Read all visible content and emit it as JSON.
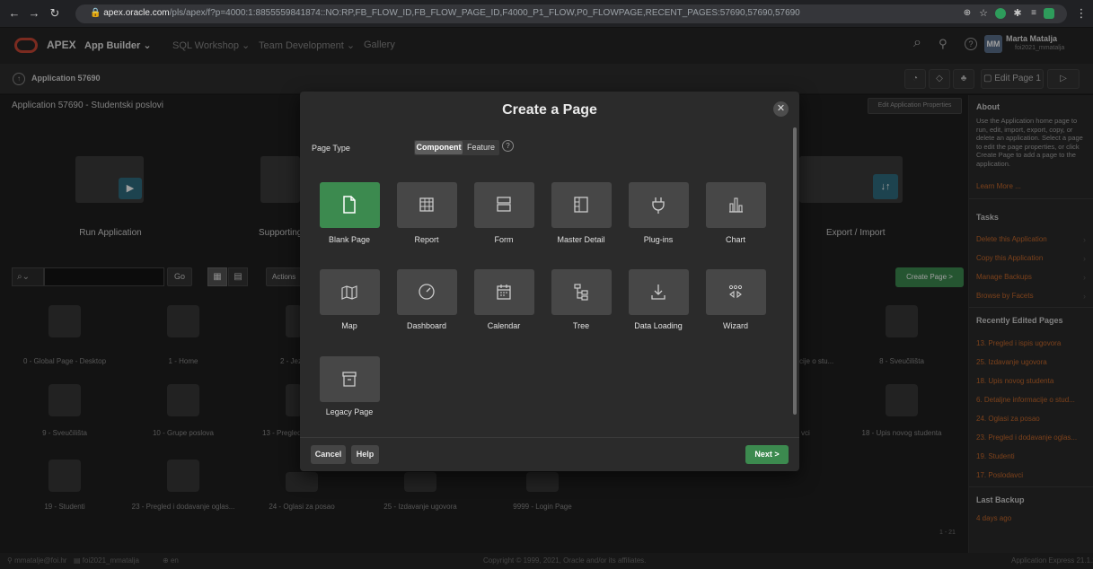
{
  "browser": {
    "url_host": "apex.oracle.com",
    "url_path": "/pls/apex/f?p=4000:1:8855559841874::NO:RP,FB_FLOW_ID,FB_FLOW_PAGE_ID,F4000_P1_FLOW,P0_FLOWPAGE,RECENT_PAGES:57690,57690,57690"
  },
  "apex_nav": {
    "logo_text": "APEX",
    "menus": [
      "App Builder",
      "SQL Workshop",
      "Team Development",
      "Gallery"
    ],
    "user_initials": "MM",
    "user_name": "Marta Matalja",
    "user_workspace": "foi2021_mmatalja"
  },
  "breadcrumb": {
    "label": "Application 57690",
    "edit_page_label": "Edit Page 1"
  },
  "main": {
    "app_title": "Application 57690 - Studentski poslovi",
    "edit_props_label": "Edit Application Properties",
    "big_tiles": [
      "Run Application",
      "Supporting Objects",
      "Export / Import"
    ],
    "search_go": "Go",
    "actions_label": "Actions",
    "create_page_label": "Create Page >",
    "pages": [
      "0 - Global Page - Desktop",
      "1 - Home",
      "2 - Jezici",
      "cije o stu...",
      "8 - Sveučilišta",
      "9 - Sveučilišta",
      "10 - Grupe poslova",
      "13 - Pregled",
      "vci",
      "18 - Upis novog studenta",
      "19 - Studenti",
      "23 - Pregled i dodavanje oglas...",
      "24 - Oglasi za posao",
      "25 - Izdavanje ugovora",
      "9999 - Login Page"
    ],
    "pagination": "1 - 21"
  },
  "sidebar": {
    "about_heading": "About",
    "about_text": "Use the Application home page to run, edit, import, export, copy, or delete an application. Select a page to edit the page properties, or click Create Page to add a page to the application.",
    "learn_more": "Learn More ...",
    "tasks_heading": "Tasks",
    "tasks": [
      "Delete this Application",
      "Copy this Application",
      "Manage Backups",
      "Browse by Facets"
    ],
    "recent_heading": "Recently Edited Pages",
    "recent": [
      "13. Pregled i ispis ugovora",
      "25. Izdavanje ugovora",
      "18. Upis novog studenta",
      "6. Detaljne informacije o stud...",
      "24. Oglasi za posao",
      "23. Pregled i dodavanje oglas...",
      "19. Studenti",
      "17. Poslodavci"
    ],
    "backup_heading": "Last Backup",
    "backup_value": "4 days ago"
  },
  "dialog": {
    "title": "Create a Page",
    "page_type_label": "Page Type",
    "toggle": {
      "component": "Component",
      "feature": "Feature"
    },
    "tiles": [
      {
        "label": "Blank Page",
        "icon": "blank-page-icon",
        "selected": true
      },
      {
        "label": "Report",
        "icon": "report-icon",
        "selected": false
      },
      {
        "label": "Form",
        "icon": "form-icon",
        "selected": false
      },
      {
        "label": "Master Detail",
        "icon": "master-detail-icon",
        "selected": false
      },
      {
        "label": "Plug-ins",
        "icon": "plug-icon",
        "selected": false
      },
      {
        "label": "Chart",
        "icon": "chart-icon",
        "selected": false
      },
      {
        "label": "Map",
        "icon": "map-icon",
        "selected": false
      },
      {
        "label": "Dashboard",
        "icon": "dashboard-icon",
        "selected": false
      },
      {
        "label": "Calendar",
        "icon": "calendar-icon",
        "selected": false
      },
      {
        "label": "Tree",
        "icon": "tree-icon",
        "selected": false
      },
      {
        "label": "Data Loading",
        "icon": "data-loading-icon",
        "selected": false
      },
      {
        "label": "Wizard",
        "icon": "wizard-icon",
        "selected": false
      },
      {
        "label": "Legacy Page",
        "icon": "legacy-page-icon",
        "selected": false
      }
    ],
    "cancel_label": "Cancel",
    "help_label": "Help",
    "next_label": "Next >"
  },
  "footer": {
    "user_email": "mmatalje@foi.hr",
    "workspace": "foi2021_mmatalja",
    "language": "en",
    "copyright": "Copyright © 1999, 2021, Oracle and/or its affiliates.",
    "version": "Application Express 21.1.2"
  },
  "colors": {
    "accent_green": "#3c8a4f",
    "link_orange": "#c96a2b",
    "logo_red": "#c74634"
  }
}
